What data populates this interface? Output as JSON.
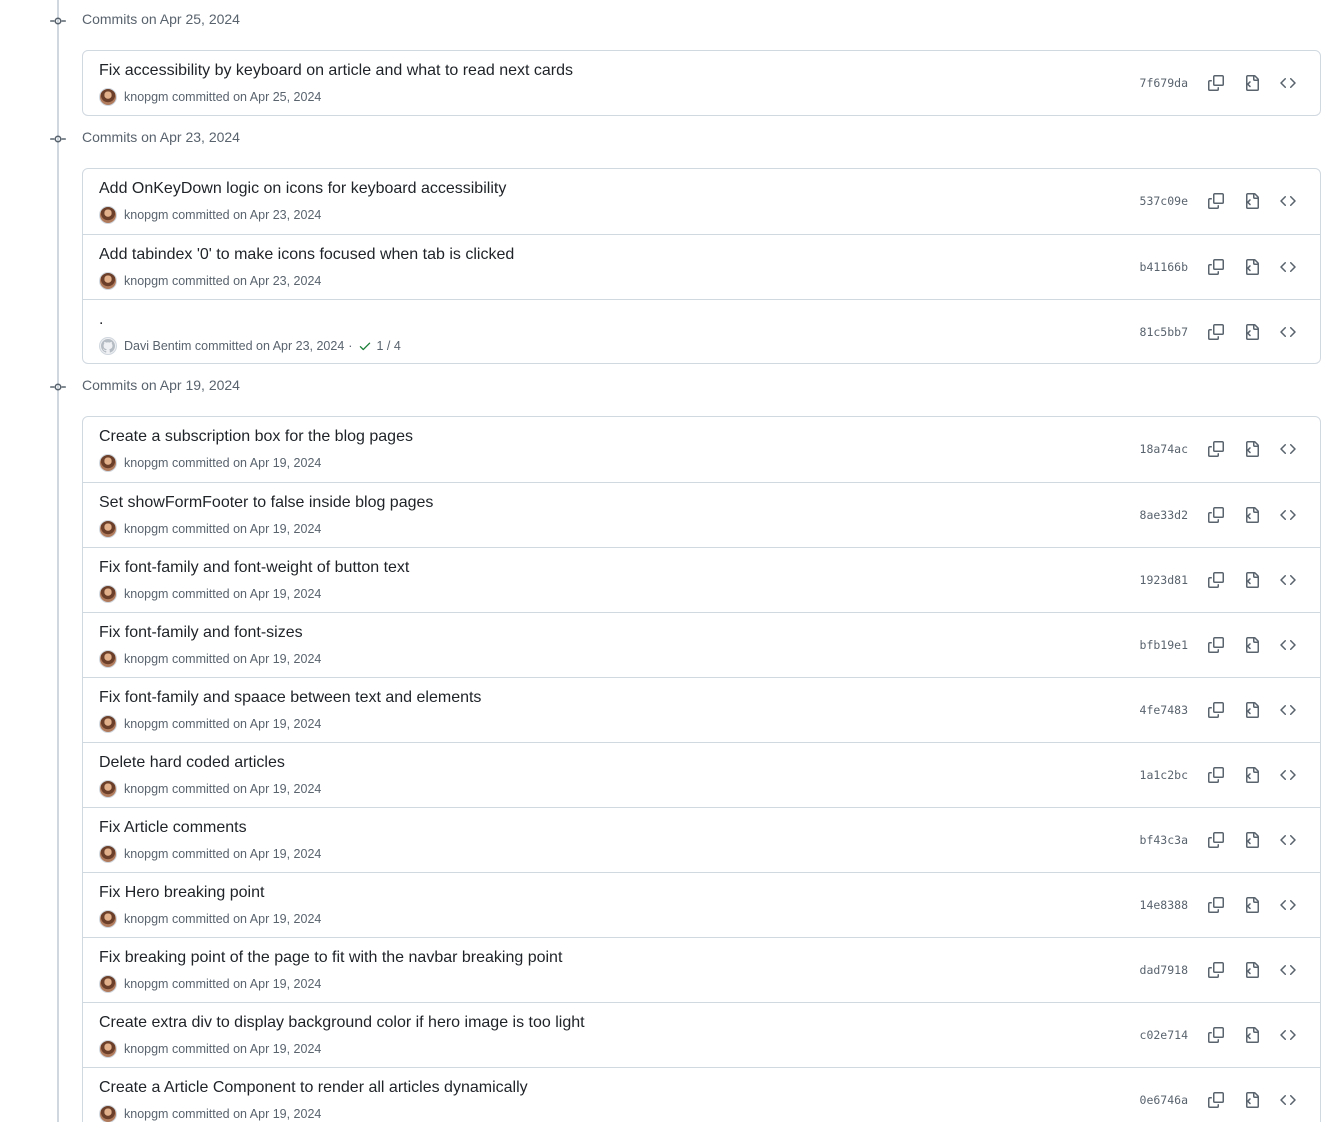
{
  "groups": [
    {
      "title": "Commits on Apr 25, 2024",
      "commits": [
        {
          "message": "Fix accessibility by keyboard on article and what to read next cards",
          "author": "knopgm",
          "action": "committed on Apr 25, 2024",
          "sha": "7f679da",
          "avatar": "photo"
        }
      ]
    },
    {
      "title": "Commits on Apr 23, 2024",
      "commits": [
        {
          "message": "Add OnKeyDown logic on icons for keyboard accessibility",
          "author": "knopgm",
          "action": "committed on Apr 23, 2024",
          "sha": "537c09e",
          "avatar": "photo"
        },
        {
          "message": "Add tabindex '0' to make icons focused when tab is clicked",
          "author": "knopgm",
          "action": "committed on Apr 23, 2024",
          "sha": "b41166b",
          "avatar": "photo"
        },
        {
          "message": ".",
          "author": "Davi Bentim",
          "action": "committed on Apr 23, 2024",
          "sha": "81c5bb7",
          "avatar": "default",
          "checks": "1 / 4"
        }
      ]
    },
    {
      "title": "Commits on Apr 19, 2024",
      "commits": [
        {
          "message": "Create a subscription box for the blog pages",
          "author": "knopgm",
          "action": "committed on Apr 19, 2024",
          "sha": "18a74ac",
          "avatar": "photo"
        },
        {
          "message": "Set showFormFooter to false inside blog pages",
          "author": "knopgm",
          "action": "committed on Apr 19, 2024",
          "sha": "8ae33d2",
          "avatar": "photo"
        },
        {
          "message": "Fix font-family and font-weight of button text",
          "author": "knopgm",
          "action": "committed on Apr 19, 2024",
          "sha": "1923d81",
          "avatar": "photo"
        },
        {
          "message": "Fix font-family and font-sizes",
          "author": "knopgm",
          "action": "committed on Apr 19, 2024",
          "sha": "bfb19e1",
          "avatar": "photo"
        },
        {
          "message": "Fix font-family and spaace between text and elements",
          "author": "knopgm",
          "action": "committed on Apr 19, 2024",
          "sha": "4fe7483",
          "avatar": "photo"
        },
        {
          "message": "Delete hard coded articles",
          "author": "knopgm",
          "action": "committed on Apr 19, 2024",
          "sha": "1a1c2bc",
          "avatar": "photo"
        },
        {
          "message": "Fix Article comments",
          "author": "knopgm",
          "action": "committed on Apr 19, 2024",
          "sha": "bf43c3a",
          "avatar": "photo"
        },
        {
          "message": "Fix Hero breaking point",
          "author": "knopgm",
          "action": "committed on Apr 19, 2024",
          "sha": "14e8388",
          "avatar": "photo"
        },
        {
          "message": "Fix breaking point of the page to fit with the navbar breaking point",
          "author": "knopgm",
          "action": "committed on Apr 19, 2024",
          "sha": "dad7918",
          "avatar": "photo"
        },
        {
          "message": "Create extra div to display background color if hero image is too light",
          "author": "knopgm",
          "action": "committed on Apr 19, 2024",
          "sha": "c02e714",
          "avatar": "photo"
        },
        {
          "message": "Create a Article Component to render all articles dynamically",
          "author": "knopgm",
          "action": "committed on Apr 19, 2024",
          "sha": "0e6746a",
          "avatar": "photo"
        }
      ]
    }
  ],
  "colors": {
    "border": "#d1d9e0",
    "muted_text": "#59636e",
    "primary_text": "#1f2328",
    "success": "#1a7f37"
  },
  "icons": {
    "copy": "copy-icon",
    "browse_files": "file-diff-icon",
    "browse_code": "code-icon",
    "timeline_node": "git-commit-icon",
    "check": "check-icon"
  }
}
